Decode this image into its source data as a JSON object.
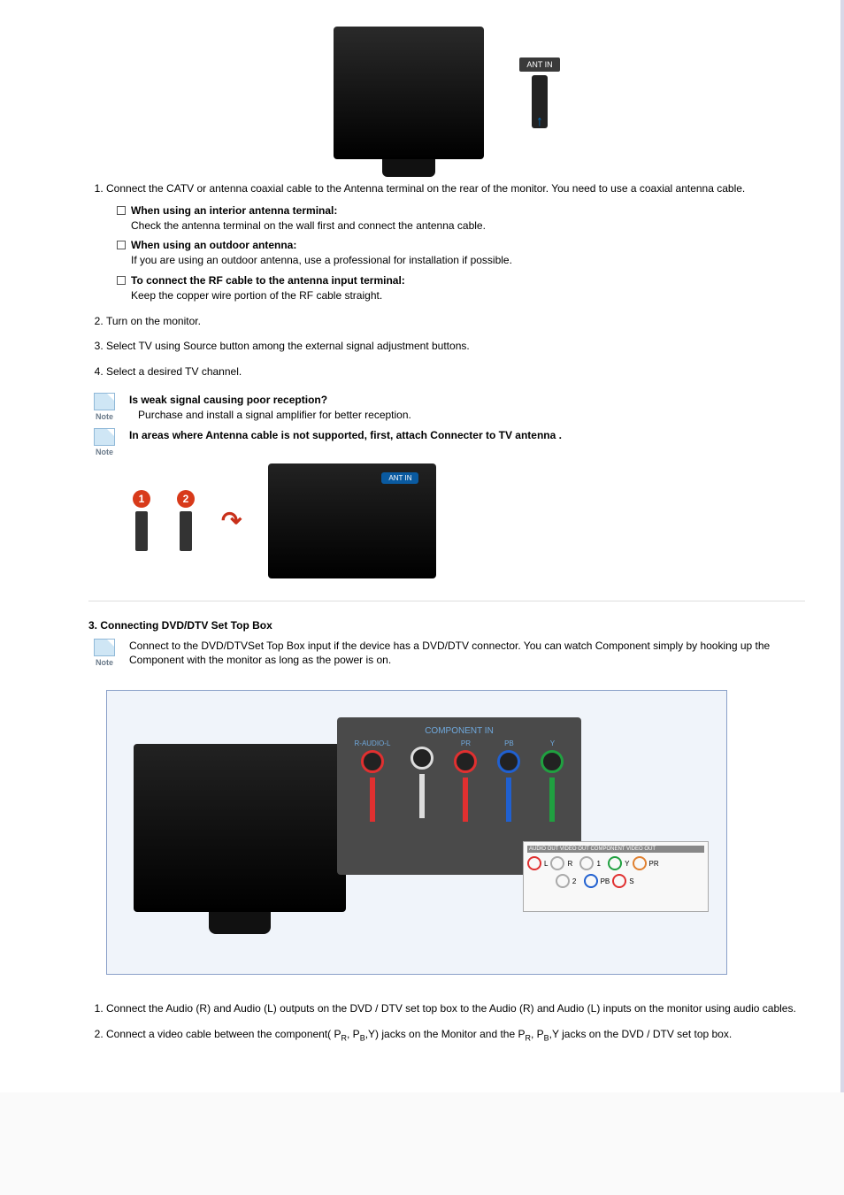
{
  "antin_label": "ANT IN",
  "step1": {
    "text": "Connect the CATV or antenna coaxial cable to the Antenna terminal on the rear of the monitor. You need to use a coaxial antenna cable.",
    "sub": [
      {
        "title": "When using an interior antenna terminal:",
        "body": "Check the antenna terminal on the wall first and connect the antenna cable."
      },
      {
        "title": "When using an outdoor antenna:",
        "body": "If you are using an outdoor antenna, use a professional for installation if possible."
      },
      {
        "title": "To connect the RF cable to the antenna input terminal:",
        "body": "Keep the copper wire portion of the RF cable straight."
      }
    ]
  },
  "step2": "Turn on the monitor.",
  "step3": "Select TV using Source button among the external signal adjustment buttons.",
  "step4": "Select a desired TV channel.",
  "note_label": "Note",
  "note1": {
    "title": "Is weak signal causing poor reception?",
    "body": "Purchase and install a signal amplifier for better reception."
  },
  "note2": {
    "title": "In areas where Antenna cable is not supported, first, attach Connecter to TV antenna ."
  },
  "diagram2": {
    "marker1": "1",
    "marker2": "2",
    "antin": "ANT IN"
  },
  "section3": {
    "title": "3. Connecting DVD/DTV Set Top Box",
    "note": "Connect to the DVD/DTVSet Top Box input if the device has a DVD/DTV connector. You can watch Component simply by hooking up the Component with the monitor as long as the power is on."
  },
  "diagram3": {
    "component_in": "COMPONENT IN",
    "jacks": [
      {
        "name": "R-AUDIO-L",
        "color": "red"
      },
      {
        "name": "",
        "color": "white"
      },
      {
        "name": "PR",
        "color": "red"
      },
      {
        "name": "PB",
        "color": "blue"
      },
      {
        "name": "Y",
        "color": "green"
      }
    ],
    "device_top": "AUDIO OUT  VIDEO OUT  COMPONENT VIDEO OUT",
    "device_labels": {
      "L": "L",
      "R": "R",
      "one": "1",
      "two": "2",
      "Y": "Y",
      "PB": "PB",
      "PR": "PR",
      "S": "S"
    }
  },
  "s3_step1": "Connect the Audio (R) and Audio (L) outputs on the DVD / DTV set top box to the Audio (R) and Audio (L) inputs on the monitor using audio cables.",
  "s3_step2_a": "Connect a video cable between the component( P",
  "s3_step2_b": ", P",
  "s3_step2_c": ",Y) jacks on the Monitor and the P",
  "s3_step2_d": ", P",
  "s3_step2_e": ",Y jacks on the DVD / DTV set top box.",
  "sub_r": "R",
  "sub_b": "B"
}
